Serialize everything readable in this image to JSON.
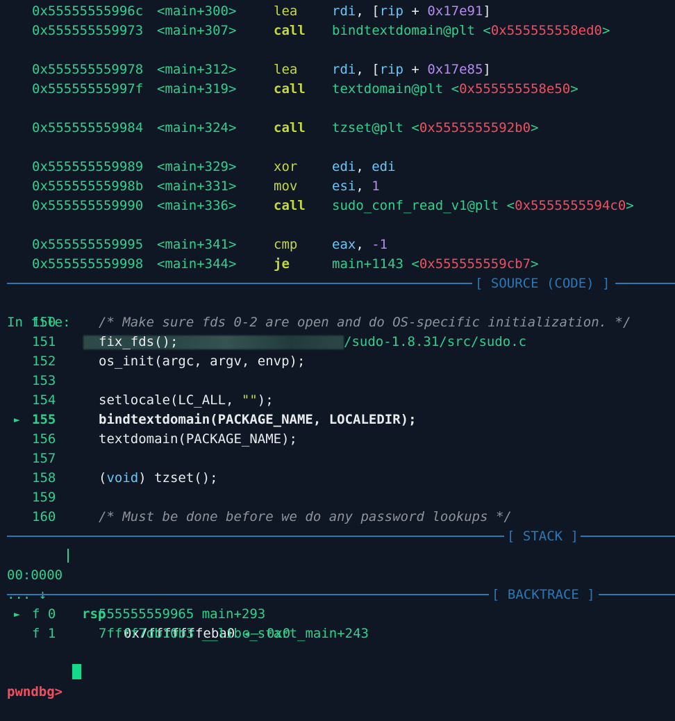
{
  "disasm": [
    {
      "addr": "0x55555555996c",
      "sym": "<main+300>",
      "mn": "lea",
      "bold": false,
      "ops": [
        {
          "t": "reg",
          "v": "rdi"
        },
        {
          "t": "pn",
          "v": ", ["
        },
        {
          "t": "reg",
          "v": "rip"
        },
        {
          "t": "pn",
          "v": " + "
        },
        {
          "t": "hex",
          "v": "0x17e91"
        },
        {
          "t": "pn",
          "v": "]"
        }
      ]
    },
    {
      "addr": "0x555555559973",
      "sym": "<main+307>",
      "mn": "call",
      "bold": true,
      "ops": [
        {
          "t": "fn",
          "v": "bindtextdomain@plt"
        },
        {
          "t": "pn",
          "v": " "
        },
        {
          "t": "fn",
          "v": "<"
        },
        {
          "t": "tgt",
          "v": "0x555555558ed0"
        },
        {
          "t": "fn",
          "v": ">"
        }
      ]
    },
    {
      "addr": "0x555555559978",
      "sym": "<main+312>",
      "mn": "lea",
      "bold": false,
      "ops": [
        {
          "t": "reg",
          "v": "rdi"
        },
        {
          "t": "pn",
          "v": ", ["
        },
        {
          "t": "reg",
          "v": "rip"
        },
        {
          "t": "pn",
          "v": " + "
        },
        {
          "t": "hex",
          "v": "0x17e85"
        },
        {
          "t": "pn",
          "v": "]"
        }
      ]
    },
    {
      "addr": "0x55555555997f",
      "sym": "<main+319>",
      "mn": "call",
      "bold": true,
      "ops": [
        {
          "t": "fn",
          "v": "textdomain@plt"
        },
        {
          "t": "pn",
          "v": " "
        },
        {
          "t": "fn",
          "v": "<"
        },
        {
          "t": "tgt",
          "v": "0x555555558e50"
        },
        {
          "t": "fn",
          "v": ">"
        }
      ]
    },
    {
      "addr": "0x555555559984",
      "sym": "<main+324>",
      "mn": "call",
      "bold": true,
      "ops": [
        {
          "t": "fn",
          "v": "tzset@plt"
        },
        {
          "t": "pn",
          "v": " "
        },
        {
          "t": "fn",
          "v": "<"
        },
        {
          "t": "tgt",
          "v": "0x5555555592b0"
        },
        {
          "t": "fn",
          "v": ">"
        }
      ]
    },
    {
      "addr": "0x555555559989",
      "sym": "<main+329>",
      "mn": "xor",
      "bold": false,
      "ops": [
        {
          "t": "reg",
          "v": "edi"
        },
        {
          "t": "pn",
          "v": ", "
        },
        {
          "t": "reg",
          "v": "edi"
        }
      ]
    },
    {
      "addr": "0x55555555998b",
      "sym": "<main+331>",
      "mn": "mov",
      "bold": false,
      "ops": [
        {
          "t": "reg",
          "v": "esi"
        },
        {
          "t": "pn",
          "v": ", "
        },
        {
          "t": "num",
          "v": "1"
        }
      ]
    },
    {
      "addr": "0x555555559990",
      "sym": "<main+336>",
      "mn": "call",
      "bold": true,
      "ops": [
        {
          "t": "fn",
          "v": "sudo_conf_read_v1@plt"
        },
        {
          "t": "pn",
          "v": " "
        },
        {
          "t": "fn",
          "v": "<"
        },
        {
          "t": "tgt",
          "v": "0x5555555594c0"
        },
        {
          "t": "fn",
          "v": ">"
        }
      ]
    },
    {
      "addr": "0x555555559995",
      "sym": "<main+341>",
      "mn": "cmp",
      "bold": false,
      "ops": [
        {
          "t": "reg",
          "v": "eax"
        },
        {
          "t": "pn",
          "v": ", "
        },
        {
          "t": "num",
          "v": "-1"
        }
      ]
    },
    {
      "addr": "0x555555559998",
      "sym": "<main+344>",
      "mn": "je",
      "bold": true,
      "ops": [
        {
          "t": "fn",
          "v": "main+1143"
        },
        {
          "t": "pn",
          "v": " "
        },
        {
          "t": "fn",
          "v": "<"
        },
        {
          "t": "tgt",
          "v": "0x555555559cb7"
        },
        {
          "t": "fn",
          "v": ">"
        }
      ]
    }
  ],
  "sections": {
    "source": "[ SOURCE (CODE) ]",
    "stack": "[ STACK ]",
    "backtrace": "[ BACKTRACE ]"
  },
  "source": {
    "file_label": "In file:",
    "file_path": "/sudo-1.8.31/src/sudo.c",
    "current_marker": "►",
    "lines": [
      {
        "n": "150",
        "cur": false,
        "segs": [
          {
            "t": "comment",
            "v": "/* Make sure fds 0-2 are open and do OS-specific initialization. */"
          }
        ]
      },
      {
        "n": "151",
        "cur": false,
        "segs": [
          {
            "t": "pn",
            "v": "fix_fds();"
          }
        ]
      },
      {
        "n": "152",
        "cur": false,
        "segs": [
          {
            "t": "pn",
            "v": "os_init(argc, argv, envp);"
          }
        ]
      },
      {
        "n": "153",
        "cur": false,
        "segs": []
      },
      {
        "n": "154",
        "cur": false,
        "segs": [
          {
            "t": "pn",
            "v": "setlocale(LC_ALL, "
          },
          {
            "t": "str",
            "v": "\"\""
          },
          {
            "t": "pn",
            "v": ");"
          }
        ]
      },
      {
        "n": "155",
        "cur": true,
        "segs": [
          {
            "t": "pn",
            "v": "bindtextdomain(PACKAGE_NAME, LOCALEDIR);"
          }
        ]
      },
      {
        "n": "156",
        "cur": false,
        "segs": [
          {
            "t": "pn",
            "v": "textdomain(PACKAGE_NAME);"
          }
        ]
      },
      {
        "n": "157",
        "cur": false,
        "segs": []
      },
      {
        "n": "158",
        "cur": false,
        "segs": [
          {
            "t": "pn",
            "v": "("
          },
          {
            "t": "kw",
            "v": "void"
          },
          {
            "t": "pn",
            "v": ") tzset();"
          }
        ]
      },
      {
        "n": "159",
        "cur": false,
        "segs": []
      },
      {
        "n": "160",
        "cur": false,
        "segs": [
          {
            "t": "comment",
            "v": "/* Must be done before we do any password lookups */"
          }
        ]
      }
    ]
  },
  "stack": {
    "index": "00:0000",
    "reg": "rsp",
    "value": "0x7fffffffeba0",
    "tail": " ◂— 0x0",
    "more": "... ↓"
  },
  "backtrace": {
    "marker": "►",
    "frames": [
      {
        "f": "f 0",
        "addr": "555555559965",
        "sym": "main+293",
        "cur": true
      },
      {
        "f": "f 1",
        "addr": "7ffff7db10b3",
        "sym": "__libc_start_main+243",
        "cur": false
      }
    ]
  },
  "prompt": "pwndbg>"
}
